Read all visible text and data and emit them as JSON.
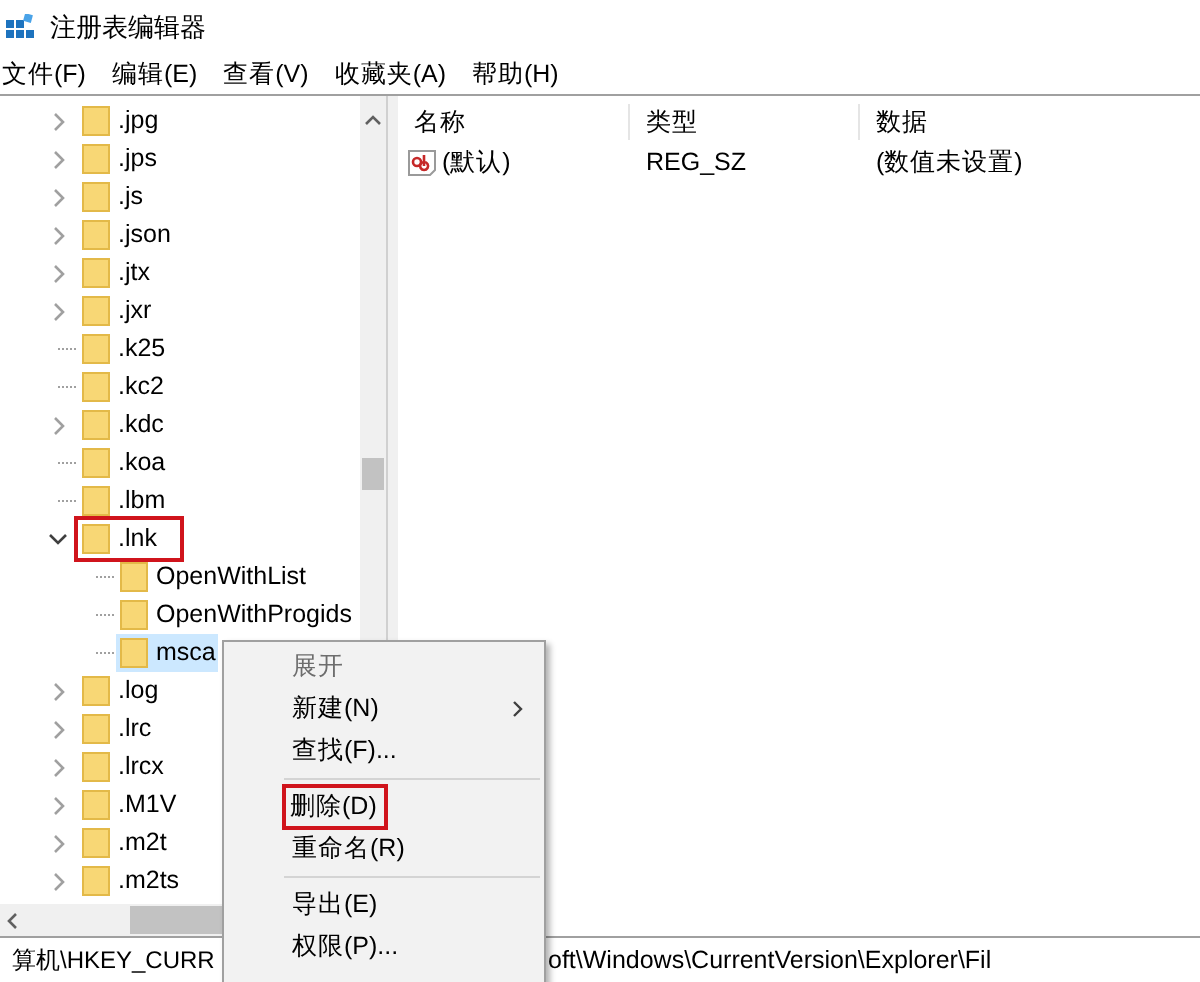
{
  "window": {
    "title": "注册表编辑器"
  },
  "menu_bar": [
    "文件(F)",
    "编辑(E)",
    "查看(V)",
    "收藏夹(A)",
    "帮助(H)"
  ],
  "tree": [
    {
      "label": ".jpg",
      "expandable": true,
      "expanded": false,
      "selected": false,
      "highlighted": false
    },
    {
      "label": ".jps",
      "expandable": true,
      "expanded": false,
      "selected": false,
      "highlighted": false
    },
    {
      "label": ".js",
      "expandable": true,
      "expanded": false,
      "selected": false,
      "highlighted": false
    },
    {
      "label": ".json",
      "expandable": true,
      "expanded": false,
      "selected": false,
      "highlighted": false
    },
    {
      "label": ".jtx",
      "expandable": true,
      "expanded": false,
      "selected": false,
      "highlighted": false
    },
    {
      "label": ".jxr",
      "expandable": true,
      "expanded": false,
      "selected": false,
      "highlighted": false
    },
    {
      "label": ".k25",
      "expandable": false,
      "expanded": false,
      "selected": false,
      "highlighted": false
    },
    {
      "label": ".kc2",
      "expandable": false,
      "expanded": false,
      "selected": false,
      "highlighted": false
    },
    {
      "label": ".kdc",
      "expandable": true,
      "expanded": false,
      "selected": false,
      "highlighted": false
    },
    {
      "label": ".koa",
      "expandable": false,
      "expanded": false,
      "selected": false,
      "highlighted": false
    },
    {
      "label": ".lbm",
      "expandable": false,
      "expanded": false,
      "selected": false,
      "highlighted": false
    },
    {
      "label": ".lnk",
      "expandable": true,
      "expanded": true,
      "selected": false,
      "highlighted": true,
      "children": [
        {
          "label": "OpenWithList",
          "expandable": false,
          "expanded": false,
          "selected": false,
          "highlighted": false
        },
        {
          "label": "OpenWithProgids",
          "expandable": false,
          "expanded": false,
          "selected": false,
          "highlighted": false
        },
        {
          "label": "msca",
          "expandable": false,
          "expanded": false,
          "selected": true,
          "highlighted": false
        }
      ]
    },
    {
      "label": ".log",
      "expandable": true,
      "expanded": false,
      "selected": false,
      "highlighted": false
    },
    {
      "label": ".lrc",
      "expandable": true,
      "expanded": false,
      "selected": false,
      "highlighted": false
    },
    {
      "label": ".lrcx",
      "expandable": true,
      "expanded": false,
      "selected": false,
      "highlighted": false
    },
    {
      "label": ".M1V",
      "expandable": true,
      "expanded": false,
      "selected": false,
      "highlighted": false
    },
    {
      "label": ".m2t",
      "expandable": true,
      "expanded": false,
      "selected": false,
      "highlighted": false
    },
    {
      "label": ".m2ts",
      "expandable": true,
      "expanded": false,
      "selected": false,
      "highlighted": false
    }
  ],
  "values_table": {
    "columns": [
      "名称",
      "类型",
      "数据"
    ],
    "rows": [
      {
        "name": "(默认)",
        "type": "REG_SZ",
        "data": "(数值未设置)"
      }
    ]
  },
  "context_menu": [
    {
      "kind": "item",
      "label": "展开",
      "disabled": true,
      "submenu": false,
      "highlighted": false
    },
    {
      "kind": "item",
      "label": "新建(N)",
      "disabled": false,
      "submenu": true,
      "highlighted": false
    },
    {
      "kind": "item",
      "label": "查找(F)...",
      "disabled": false,
      "submenu": false,
      "highlighted": false
    },
    {
      "kind": "separator"
    },
    {
      "kind": "item",
      "label": "删除(D)",
      "disabled": false,
      "submenu": false,
      "highlighted": true
    },
    {
      "kind": "item",
      "label": "重命名(R)",
      "disabled": false,
      "submenu": false,
      "highlighted": false
    },
    {
      "kind": "separator"
    },
    {
      "kind": "item",
      "label": "导出(E)",
      "disabled": false,
      "submenu": false,
      "highlighted": false
    },
    {
      "kind": "item",
      "label": "权限(P)...",
      "disabled": false,
      "submenu": false,
      "highlighted": false
    }
  ],
  "status_bar": {
    "path_start": "算机\\HKEY_CURR",
    "path_end": "oft\\Windows\\CurrentVersion\\Explorer\\Fil"
  }
}
